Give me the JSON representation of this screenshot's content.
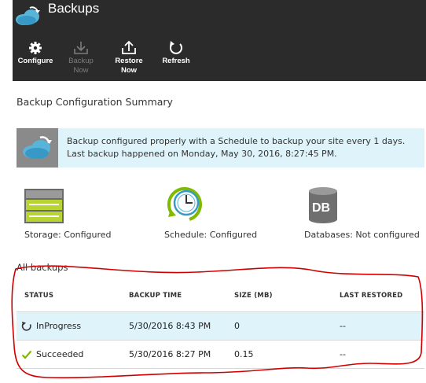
{
  "header": {
    "title": "Backups",
    "toolbar": [
      {
        "label": "Configure",
        "icon": "gear-icon",
        "enabled": true
      },
      {
        "label": "Backup\nNow",
        "icon": "download-icon",
        "enabled": false
      },
      {
        "label": "Restore\nNow",
        "icon": "upload-icon",
        "enabled": true
      },
      {
        "label": "Refresh",
        "icon": "refresh-icon",
        "enabled": true
      }
    ]
  },
  "summary": {
    "title": "Backup Configuration Summary",
    "banner_message": "Backup configured properly with a Schedule to backup your site every 1 days. Last backup happened on Monday, May 30, 2016, 8:27:45 PM."
  },
  "status_items": [
    {
      "label": "Storage: Configured",
      "icon": "storage-icon"
    },
    {
      "label": "Schedule: Configured",
      "icon": "schedule-clock-icon"
    },
    {
      "label": "Databases: Not configured",
      "icon": "database-icon"
    }
  ],
  "database_icon_text": "DB",
  "backups": {
    "title": "All backups",
    "columns": [
      "STATUS",
      "BACKUP TIME",
      "SIZE (MB)",
      "LAST RESTORED"
    ],
    "rows": [
      {
        "status": "InProgress",
        "status_icon": "in-progress-icon",
        "time": "5/30/2016 8:43 PM",
        "size": "0",
        "last_restored": "--",
        "selected": true
      },
      {
        "status": "Succeeded",
        "status_icon": "check-icon",
        "time": "5/30/2016 8:27 PM",
        "size": "0.15",
        "last_restored": "--",
        "selected": false
      }
    ]
  },
  "colors": {
    "header_bg": "#2b2b2b",
    "banner_bg": "#dff3fb",
    "selected_row_bg": "#dff3fb",
    "annotation_red": "#d10000",
    "success_green": "#7fba00"
  }
}
